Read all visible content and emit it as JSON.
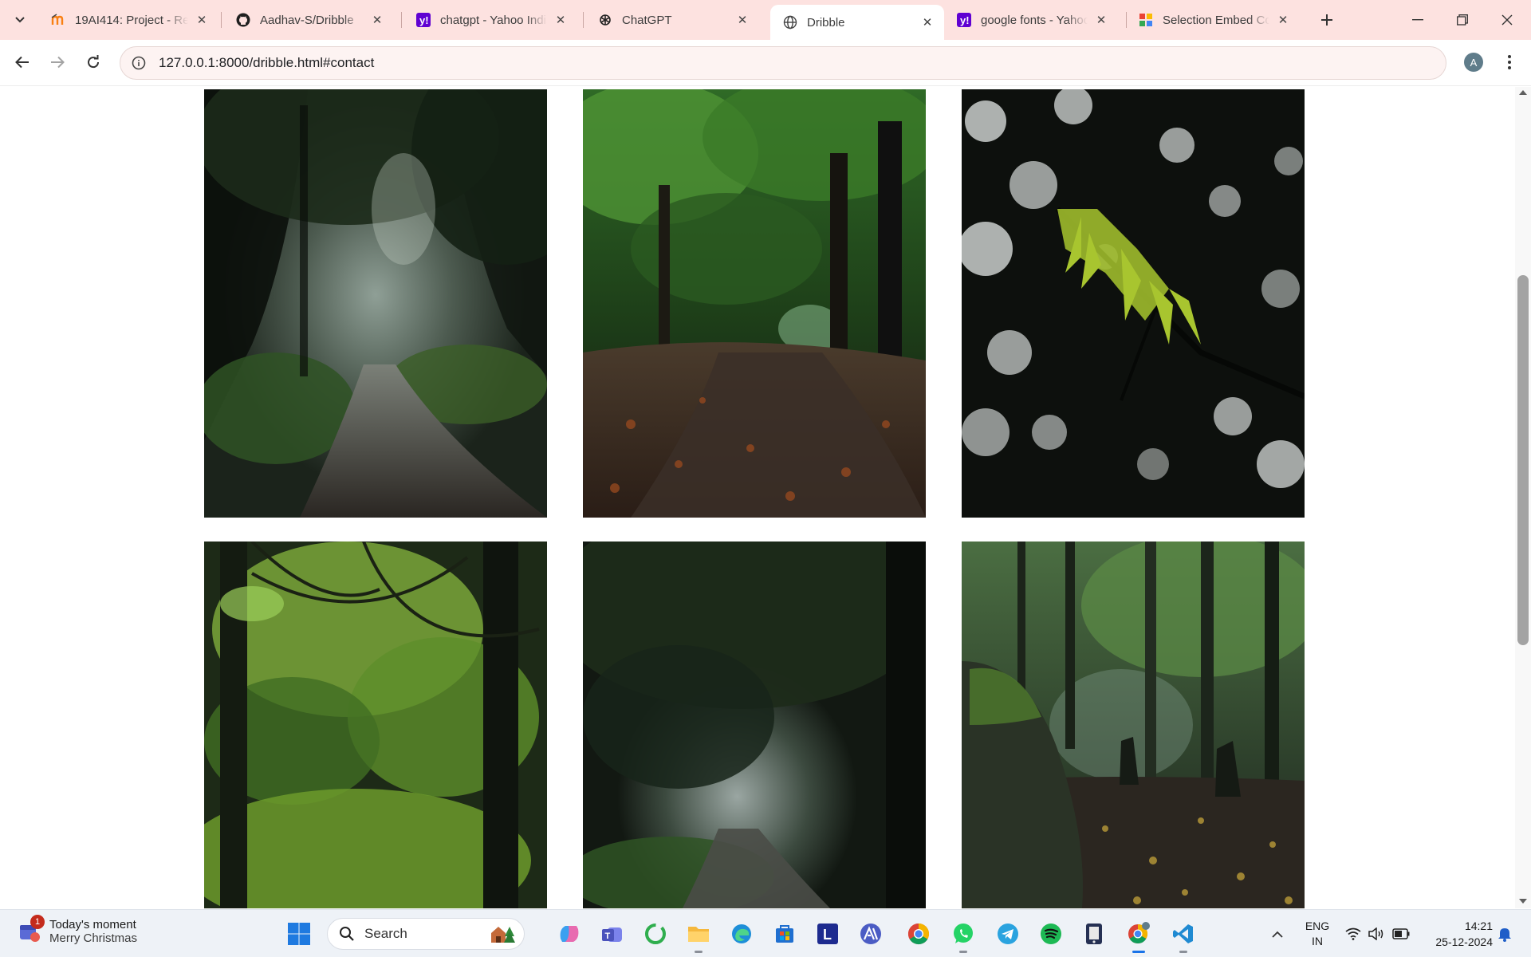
{
  "browser": {
    "tabs": [
      {
        "title": "19AI414: Project - Re",
        "favicon": "moodle-icon",
        "active": false
      },
      {
        "title": "Aadhav-S/Dribble",
        "favicon": "github-icon",
        "active": false
      },
      {
        "title": "chatgpt - Yahoo India",
        "favicon": "yahoo-icon",
        "active": false
      },
      {
        "title": "ChatGPT",
        "favicon": "openai-icon",
        "active": false
      },
      {
        "title": "Dribble",
        "favicon": "globe-icon",
        "active": true
      },
      {
        "title": "google fonts - Yahoo",
        "favicon": "yahoo-icon",
        "active": false
      },
      {
        "title": "Selection Embed Cod",
        "favicon": "google-icon",
        "active": false
      }
    ],
    "address": "127.0.0.1:8000/dribble.html#contact",
    "profile_initial": "A"
  },
  "gallery": {
    "photos": [
      {
        "name": "misty-forest-path"
      },
      {
        "name": "autumn-leaf-trail"
      },
      {
        "name": "moss-branch-bokeh"
      },
      {
        "name": "green-woodland-ferns"
      },
      {
        "name": "dark-tunnel-path"
      },
      {
        "name": "mossy-rock-forest"
      }
    ]
  },
  "taskbar": {
    "widget_title": "Today's moment",
    "widget_subtitle": "Merry Christmas",
    "widget_badge": "1",
    "search_label": "Search",
    "apps": [
      "copilot-icon",
      "teams-icon",
      "circle-app-icon",
      "file-explorer-icon",
      "edge-icon",
      "store-icon",
      "l-app-icon",
      "ai-app-icon",
      "chrome-icon",
      "whatsapp-icon",
      "telegram-icon",
      "spotify-icon",
      "device-app-icon",
      "chrome-profile-icon",
      "vscode-icon"
    ],
    "lang_line1": "ENG",
    "lang_line2": "IN",
    "time": "14:21",
    "date": "25-12-2024"
  },
  "colors": {
    "tabstrip_bg": "#fde2e0",
    "accent": "#1a73e8"
  }
}
